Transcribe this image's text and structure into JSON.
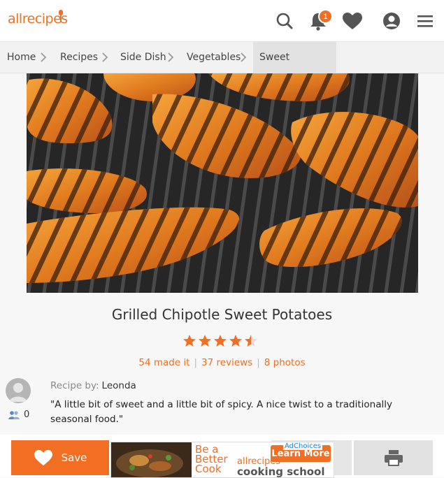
{
  "header": {
    "logo_text": "allrecipes",
    "notification_count": "1",
    "brand_color": "#f26e22",
    "icons": [
      "search-icon",
      "bell-icon",
      "heart-icon",
      "user-icon",
      "menu-icon"
    ]
  },
  "breadcrumb": {
    "items": [
      "Home",
      "Recipes",
      "Side Dish",
      "Vegetables",
      "Sweet Potatoes"
    ]
  },
  "recipe": {
    "title": "Grilled Chipotle Sweet Potatoes",
    "rating": 4.5,
    "made_it": "54 made it",
    "reviews": "37 reviews",
    "photos": "8 photos",
    "byline_label": "Recipe by:",
    "author": "Leonda",
    "made_count": "0",
    "description": "\"A little bit of sweet and a little bit of spicy. A nice twist to a traditionally seasonal food.\""
  },
  "bottom_bar": {
    "save_label": "Save",
    "ad": {
      "line1": "Be a",
      "line2": "Better",
      "line3": "Cook",
      "logo": "allrecipes",
      "school": "cooking school",
      "cta": "Learn More",
      "adchoices": "AdChoices"
    }
  }
}
